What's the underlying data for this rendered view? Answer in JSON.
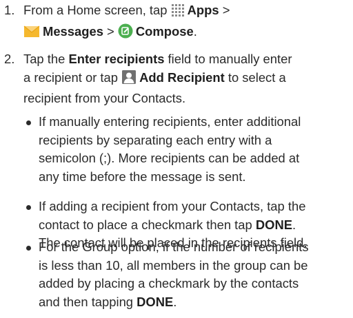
{
  "steps": [
    {
      "number": "1.",
      "line1_prefix": "From a Home screen, tap ",
      "apps_label": "Apps",
      "apps_sep": " >",
      "messages_label": "Messages",
      "messages_sep": " > ",
      "compose_label": "Compose",
      "compose_suffix": ".",
      "icons": [
        "apps-grid-icon",
        "messages-envelope-icon",
        "compose-icon"
      ],
      "icon_colors": {
        "apps": "#8a8a8a",
        "messages": "#f5b82e",
        "compose": "#4caf50"
      }
    },
    {
      "number": "2.",
      "line1_prefix": "Tap the ",
      "enter_recipients_label": "Enter recipients",
      "line1_suffix": " field to manually enter",
      "line2_prefix": "a recipient or tap ",
      "add_recipient_label": "Add Recipient",
      "line2_suffix": " to select a",
      "line3": "recipient from your Contacts.",
      "icons": [
        "add-recipient-icon"
      ]
    }
  ],
  "bullets": [
    {
      "lines": [
        "If manually entering recipients, enter additional",
        "recipients by separating each entry with a",
        "semicolon (;). More recipients can be added at",
        "any time before the message is sent."
      ]
    },
    {
      "line1": "If adding a recipient from your Contacts, tap the",
      "line2_prefix": "contact to place a checkmark then tap ",
      "done_label": "DONE",
      "line2_suffix": ".",
      "line3": "The contact will be placed in the recipients field."
    },
    {
      "line1": "For the Group option, if the number of recipients",
      "line2": "is less than 10, all members in the group can be",
      "line3": "added by placing a checkmark by the contacts",
      "line4_prefix": "and then tapping ",
      "done_label": "DONE",
      "line4_suffix": "."
    }
  ]
}
